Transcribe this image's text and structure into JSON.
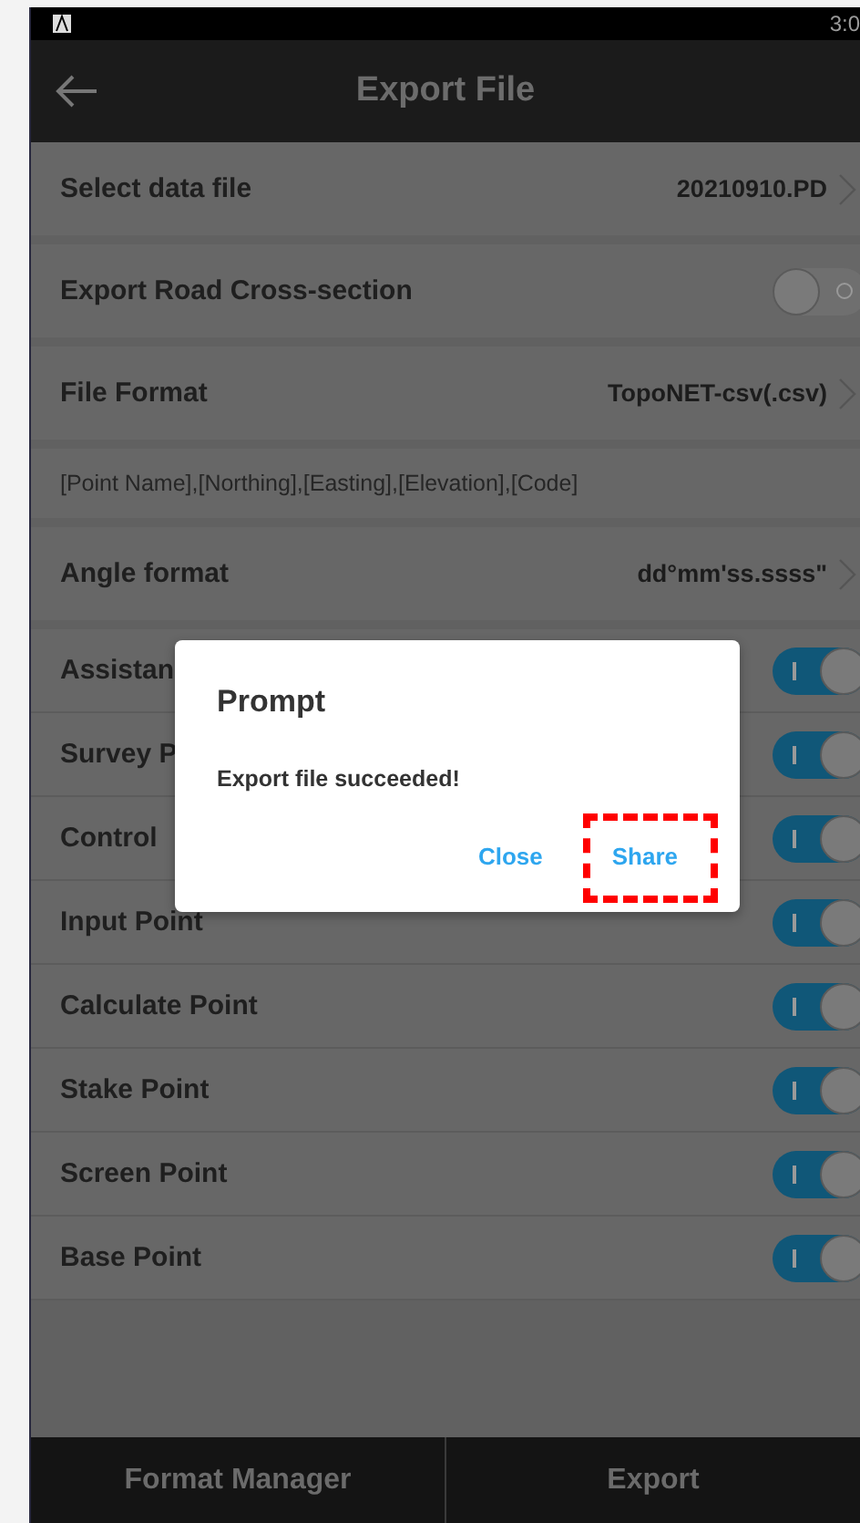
{
  "status_bar": {
    "time": "3:0"
  },
  "header": {
    "title": "Export File"
  },
  "sections": [
    {
      "rows": [
        {
          "kind": "link",
          "label": "Select data file",
          "value": "20210910.PD"
        }
      ]
    },
    {
      "rows": [
        {
          "kind": "toggle",
          "label": "Export Road Cross-section",
          "on": false
        }
      ]
    },
    {
      "rows": [
        {
          "kind": "link",
          "label": "File Format",
          "value": "TopoNET-csv(.csv)"
        }
      ]
    },
    {
      "rows": [
        {
          "kind": "note",
          "label": "[Point Name],[Northing],[Easting],[Elevation],[Code]"
        }
      ]
    },
    {
      "rows": [
        {
          "kind": "link",
          "label": "Angle format",
          "value": "dd°mm'ss.ssss\""
        }
      ]
    },
    {
      "rows": [
        {
          "kind": "toggle",
          "label": "Assistan",
          "on": true
        },
        {
          "kind": "toggle",
          "label": "Survey P",
          "on": true
        },
        {
          "kind": "toggle",
          "label": "Control",
          "on": true
        },
        {
          "kind": "toggle",
          "label": "Input Point",
          "on": true
        },
        {
          "kind": "toggle",
          "label": "Calculate Point",
          "on": true
        },
        {
          "kind": "toggle",
          "label": "Stake Point",
          "on": true
        },
        {
          "kind": "toggle",
          "label": "Screen Point",
          "on": true
        },
        {
          "kind": "toggle",
          "label": "Base Point",
          "on": true
        }
      ]
    }
  ],
  "footer": {
    "buttons": [
      "Format Manager",
      "Export"
    ]
  },
  "dialog": {
    "title": "Prompt",
    "message": "Export file succeeded!",
    "buttons": [
      {
        "label": "Close",
        "highlighted": false
      },
      {
        "label": "Share",
        "highlighted": true
      }
    ]
  }
}
